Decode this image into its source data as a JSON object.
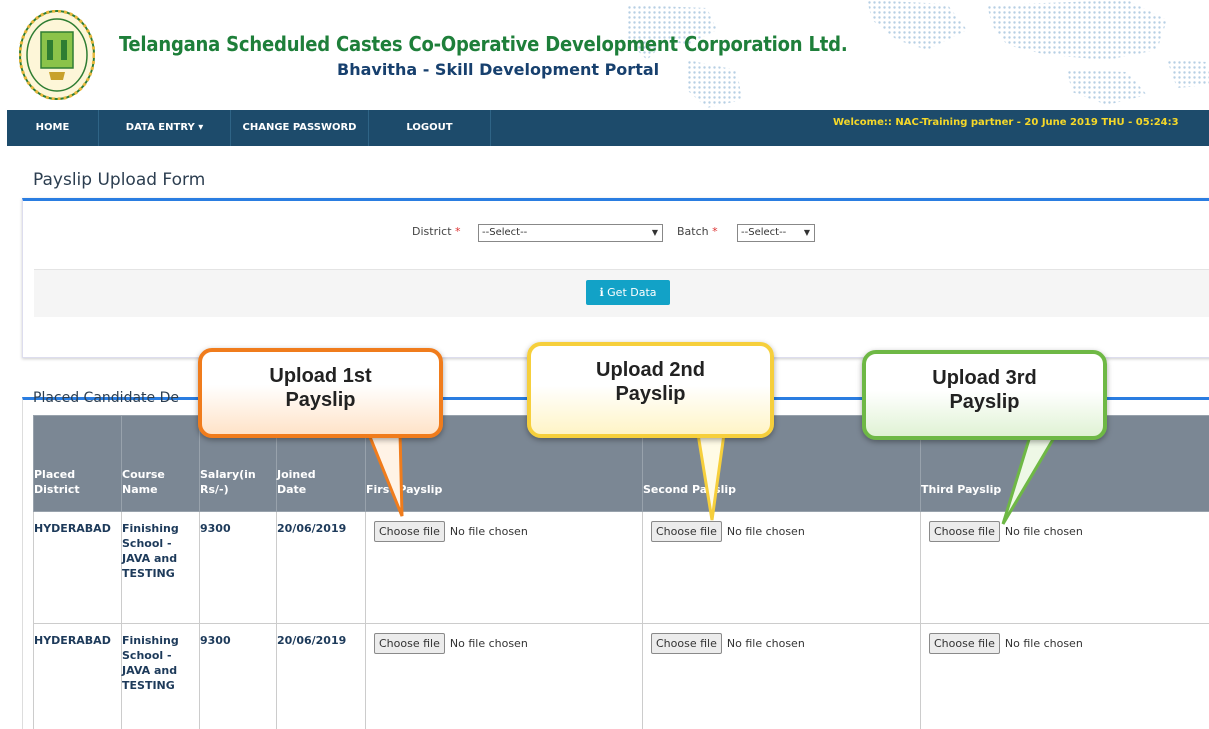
{
  "header": {
    "title": "Telangana Scheduled Castes Co-Operative Development Corporation Ltd.",
    "subtitle": "Bhavitha - Skill Development Portal"
  },
  "nav": {
    "items": [
      {
        "label": "HOME"
      },
      {
        "label": "DATA ENTRY ▾"
      },
      {
        "label": "CHANGE PASSWORD"
      },
      {
        "label": "LOGOUT"
      }
    ],
    "welcome": "Welcome:: NAC-Training partner - 20 June 2019 THU - 05:24:3"
  },
  "form": {
    "title": "Payslip Upload Form",
    "district_label": "District",
    "district_value": "--Select--",
    "batch_label": "Batch",
    "batch_value": "--Select--",
    "get_data": "Get Data",
    "required_mark": "*"
  },
  "table": {
    "section_title": "Placed Candidate De",
    "headers": [
      "Placed District",
      "Course Name",
      "Salary(in Rs/-)",
      "Joined Date",
      "First Payslip",
      "Second Payslip",
      "Third Payslip"
    ],
    "choose_label": "Choose file",
    "no_file": "No file chosen",
    "rows": [
      {
        "district": "HYDERABAD",
        "course": "Finishing School - JAVA and TESTING",
        "salary": "9300",
        "joined": "20/06/2019"
      },
      {
        "district": "HYDERABAD",
        "course": "Finishing School - JAVA and TESTING",
        "salary": "9300",
        "joined": "20/06/2019"
      }
    ]
  },
  "callouts": {
    "first": "Upload 1st Payslip",
    "second": "Upload 2nd Payslip",
    "third": "Upload 3rd Payslip"
  },
  "colors": {
    "nav_bg": "#1d4b6b",
    "accent": "#2a7de1",
    "title_green": "#1e7f3a",
    "button": "#12a2c7",
    "welcome": "#f5d829"
  }
}
